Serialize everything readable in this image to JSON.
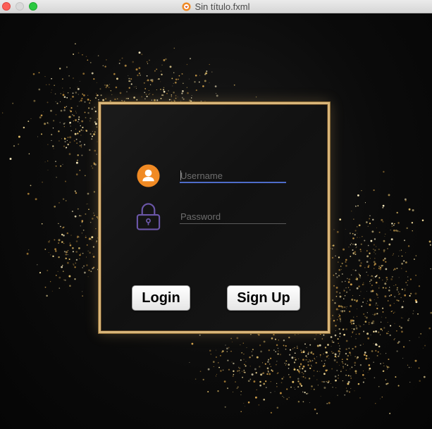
{
  "window": {
    "title": "Sin título.fxml",
    "app_icon": "scene-builder-icon",
    "controls": [
      "close",
      "minimize",
      "zoom"
    ]
  },
  "form": {
    "username": {
      "placeholder": "Username",
      "value": "",
      "icon": "user-icon"
    },
    "password": {
      "placeholder": "Password",
      "value": "",
      "icon": "lock-icon"
    },
    "login_label": "Login",
    "signup_label": "Sign Up"
  },
  "colors": {
    "frame_gold": "#d9b67a",
    "user_icon_orange": "#f08a24",
    "lock_icon_purple": "#6b56a8",
    "username_focus_underline": "#4e6cc9",
    "background": "#0b0b0b"
  }
}
